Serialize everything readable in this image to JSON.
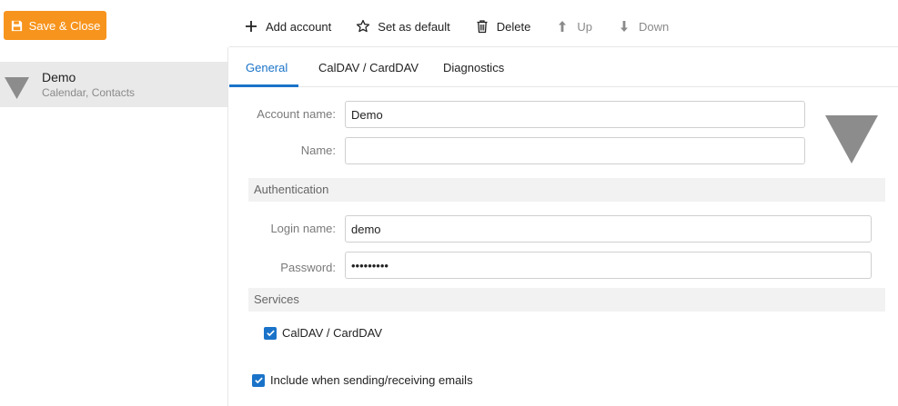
{
  "toolbar": {
    "save_close_label": "Save & Close",
    "add_account_label": "Add account",
    "set_default_label": "Set as default",
    "delete_label": "Delete",
    "up_label": "Up",
    "down_label": "Down"
  },
  "sidebar": {
    "accounts": [
      {
        "name": "Demo",
        "description": "Calendar, Contacts",
        "selected": true
      }
    ]
  },
  "tabs": [
    {
      "label": "General",
      "active": true
    },
    {
      "label": "CalDAV / CardDAV",
      "active": false
    },
    {
      "label": "Diagnostics",
      "active": false
    }
  ],
  "form": {
    "account_name_label": "Account name:",
    "account_name_value": "Demo",
    "name_label": "Name:",
    "name_value": "",
    "authentication_heading": "Authentication",
    "login_name_label": "Login name:",
    "login_name_value": "demo",
    "password_label": "Password:",
    "password_value": "demo12345",
    "services_heading": "Services",
    "caldav_checkbox_label": "CalDAV / CardDAV",
    "caldav_checked": true,
    "include_emails_label": "Include when sending/receiving emails",
    "include_emails_checked": true
  },
  "colors": {
    "accent": "#1a73c8",
    "save_button": "#f7941d",
    "selected_row": "#e9e9e9",
    "account_icon": "#8c8c8c"
  }
}
